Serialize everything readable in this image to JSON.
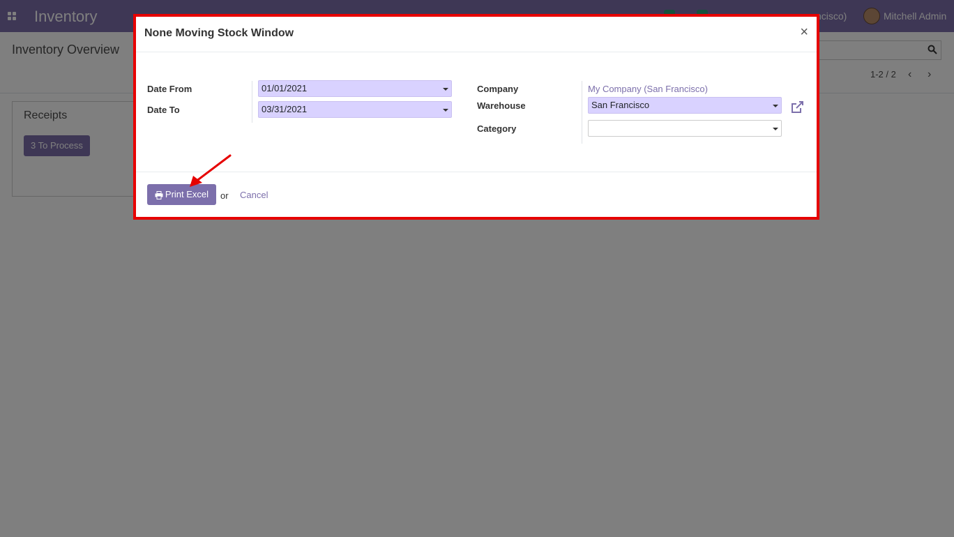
{
  "navbar": {
    "app_name": "Inventory",
    "company_fragment": "ncisco)",
    "user_name": "Mitchell Admin"
  },
  "control_panel": {
    "title": "Inventory Overview",
    "pager": "1-2 / 2"
  },
  "kanban": {
    "card_title": "Receipts",
    "card_button": "3 To Process"
  },
  "modal": {
    "title": "None Moving Stock Window",
    "close_glyph": "×",
    "left_fields": {
      "date_from_label": "Date From",
      "date_from_value": "01/01/2021",
      "date_to_label": "Date To",
      "date_to_value": "03/31/2021"
    },
    "right_fields": {
      "company_label": "Company",
      "company_value": "My Company (San Francisco)",
      "warehouse_label": "Warehouse",
      "warehouse_value": "San Francisco",
      "category_label": "Category",
      "category_value": ""
    },
    "footer": {
      "print_label": "Print Excel",
      "or_text": "or",
      "cancel_label": "Cancel"
    }
  },
  "colors": {
    "brand": "#7c6fab",
    "highlight_border": "#e60000",
    "field_fill": "#d9d2ff"
  }
}
